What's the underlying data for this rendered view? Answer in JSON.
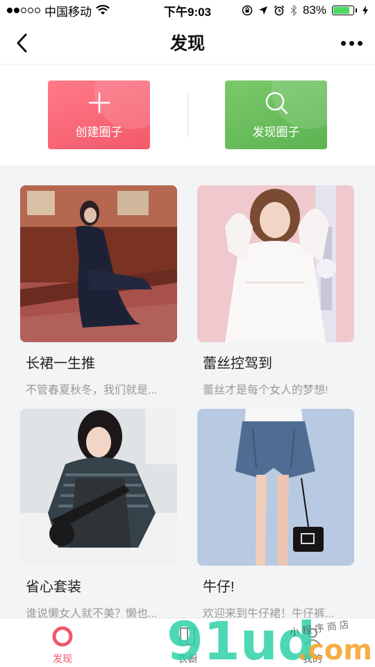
{
  "status_bar": {
    "carrier": "中国移动",
    "time": "下午9:03",
    "battery": "83%",
    "battery_level": 0.83
  },
  "nav": {
    "title": "发现"
  },
  "actions": {
    "create_label": "创建圈子",
    "discover_label": "发现圈子"
  },
  "cards": [
    {
      "title": "长裙一生推",
      "desc": "不管春夏秋冬，我们就是..."
    },
    {
      "title": "蕾丝控驾到",
      "desc": "蕾丝才是每个女人的梦想!"
    },
    {
      "title": "省心套装",
      "desc": "谁说懒女人就不美？懒也..."
    },
    {
      "title": "牛仔!",
      "desc": "欢迎来到牛仔裙！牛仔裤..."
    }
  ],
  "tabs": [
    {
      "label": "发现"
    },
    {
      "label": "衣橱"
    },
    {
      "label": "我的"
    }
  ],
  "watermark": {
    "text": "91ud",
    "suffix": ".com",
    "tagline": "小程序商店"
  },
  "colors": {
    "accent": "#f0566a",
    "create": "#f35a6c",
    "discover": "#5cb352"
  }
}
